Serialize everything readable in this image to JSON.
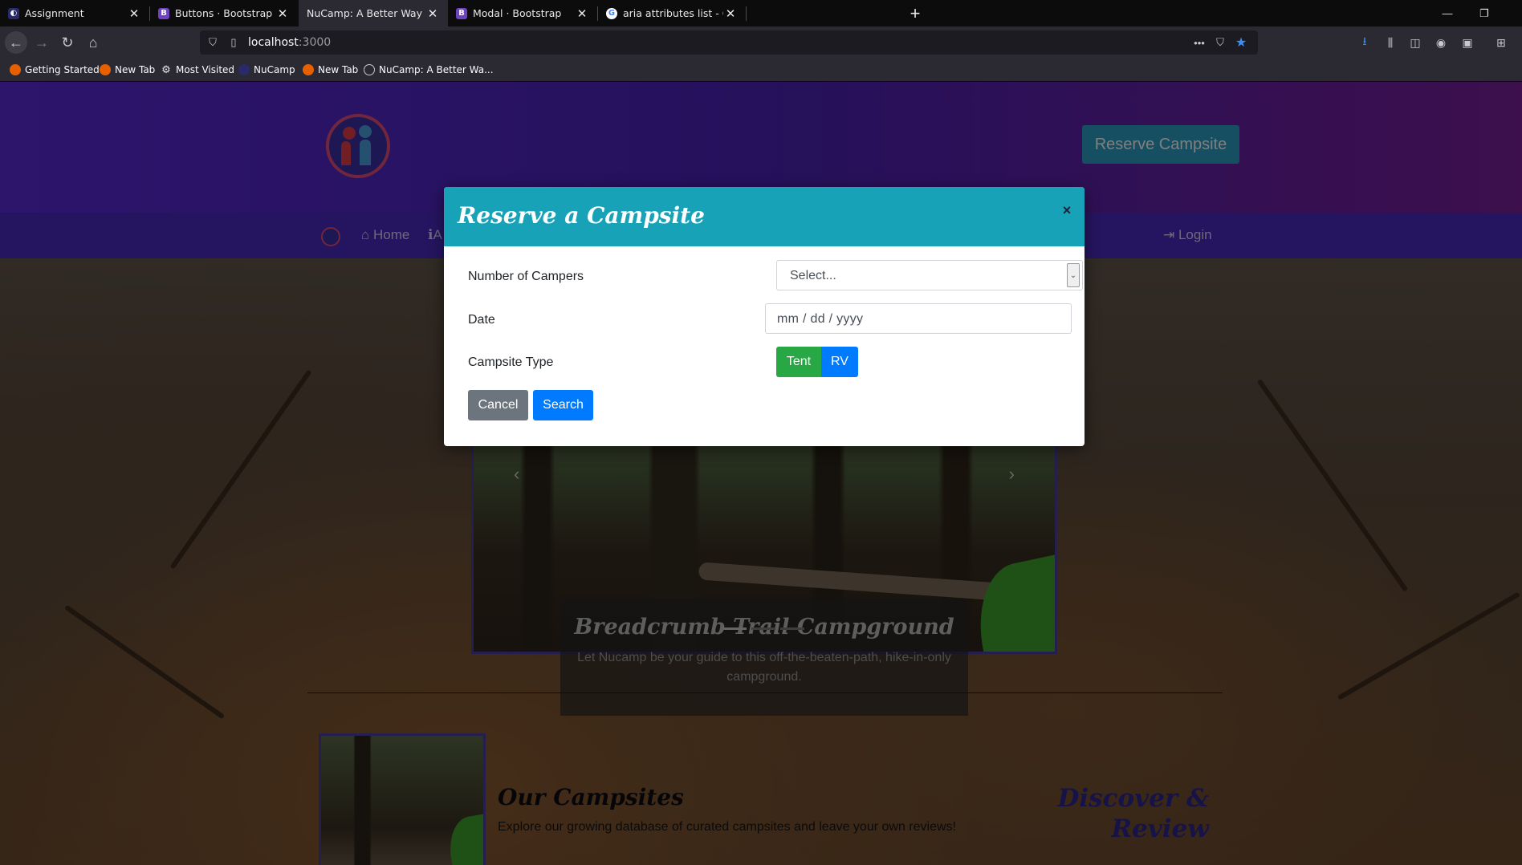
{
  "browser": {
    "tabs": [
      {
        "title": "Assignment",
        "active": false
      },
      {
        "title": "Buttons · Bootstrap",
        "active": false
      },
      {
        "title": "NuCamp: A Better Way To Camp",
        "active": true
      },
      {
        "title": "Modal · Bootstrap",
        "active": false
      },
      {
        "title": "aria attributes list - Google Sear",
        "active": false
      }
    ],
    "tab_close_glyph": "✕",
    "new_tab_glyph": "+",
    "url_host": "localhost",
    "url_port": ":3000",
    "bookmarks": [
      {
        "label": "Getting Started",
        "icon": "firefox-icon"
      },
      {
        "label": "New Tab",
        "icon": "firefox-icon"
      },
      {
        "label": "Most Visited",
        "icon": "gear-icon"
      },
      {
        "label": "NuCamp",
        "icon": "nucamp-icon"
      },
      {
        "label": "New Tab",
        "icon": "firefox-icon"
      },
      {
        "label": "NuCamp: A Better Wa...",
        "icon": "globe-icon"
      }
    ]
  },
  "site": {
    "reserve_button": "Reserve Campsite",
    "nav": {
      "home": "Home",
      "about_partial": "A",
      "login": "Login"
    },
    "carousel": {
      "title": "Breadcrumb Trail Campground",
      "subtitle": "Let Nucamp be your guide to this off-the-beaten-path, hike-in-only campground.",
      "active_index": 0,
      "indicator_count": 3
    },
    "campsites": {
      "title": "Our Campsites",
      "text": "Explore our growing database of curated campsites and leave your own reviews!"
    },
    "discover": {
      "line1": "Discover &",
      "line2": "Review"
    }
  },
  "modal": {
    "title": "Reserve a Campsite",
    "close_glyph": "×",
    "campers_label": "Number of Campers",
    "campers_value": "Select...",
    "date_label": "Date",
    "date_placeholder": "mm / dd / yyyy",
    "type_label": "Campsite Type",
    "type_options": [
      "Tent",
      "RV"
    ],
    "cancel_label": "Cancel",
    "search_label": "Search"
  },
  "colors": {
    "modal_header": "#17a2b8",
    "tent_active": "#28a745",
    "primary": "#007bff",
    "secondary": "#6c757d",
    "jumbotron": "#5b2ad9"
  }
}
